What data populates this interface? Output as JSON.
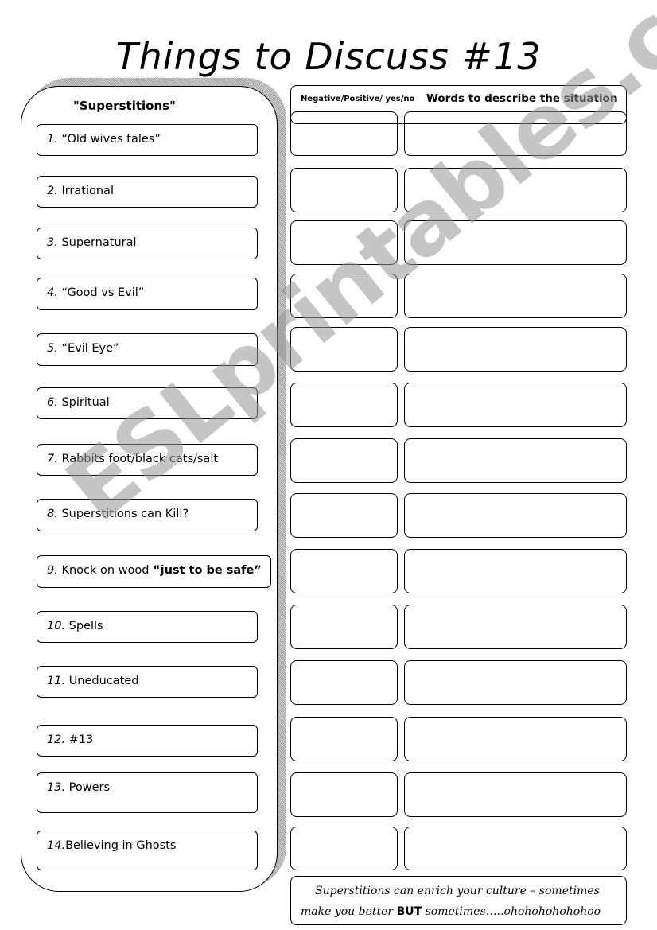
{
  "title": "Things to Discuss #13",
  "panel": {
    "heading": "\"Superstitions\"",
    "items": [
      {
        "num": "1.",
        "text": " “Old wives tales”",
        "bold": ""
      },
      {
        "num": "2.",
        "text": " Irrational",
        "bold": ""
      },
      {
        "num": "3.",
        "text": " Supernatural",
        "bold": ""
      },
      {
        "num": "4.",
        "text": " “Good vs Evil”",
        "bold": ""
      },
      {
        "num": "5.",
        "text": " “Evil Eye”",
        "bold": ""
      },
      {
        "num": "6.",
        "text": " Spiritual",
        "bold": ""
      },
      {
        "num": "7.",
        "text": " Rabbits foot/black cats/salt",
        "bold": ""
      },
      {
        "num": "8.",
        "text": " Superstitions can Kill?",
        "bold": ""
      },
      {
        "num": "9.",
        "text": " Knock on wood ",
        "bold": "“just to be safe”"
      },
      {
        "num": "10.",
        "text": " Spells",
        "bold": ""
      },
      {
        "num": "11.",
        "text": " Uneducated",
        "bold": ""
      },
      {
        "num": "12.",
        "text": "  #13",
        "bold": ""
      },
      {
        "num": "13.",
        "text": " Powers",
        "bold": ""
      },
      {
        "num": "14.",
        "text": "Believing in Ghosts",
        "bold": ""
      }
    ]
  },
  "grid": {
    "header_col_a": "Negative/Positive/ yes/no",
    "header_col_b": "Words to describe the situation",
    "row_count": 14
  },
  "footer": {
    "line1": "Superstitions can enrich your culture – sometimes",
    "line2_pre": "make you better ",
    "line2_bold": "BUT",
    "line2_post": " sometimes…..ohohohohohohoo"
  },
  "watermark": "ESLprintables.com"
}
